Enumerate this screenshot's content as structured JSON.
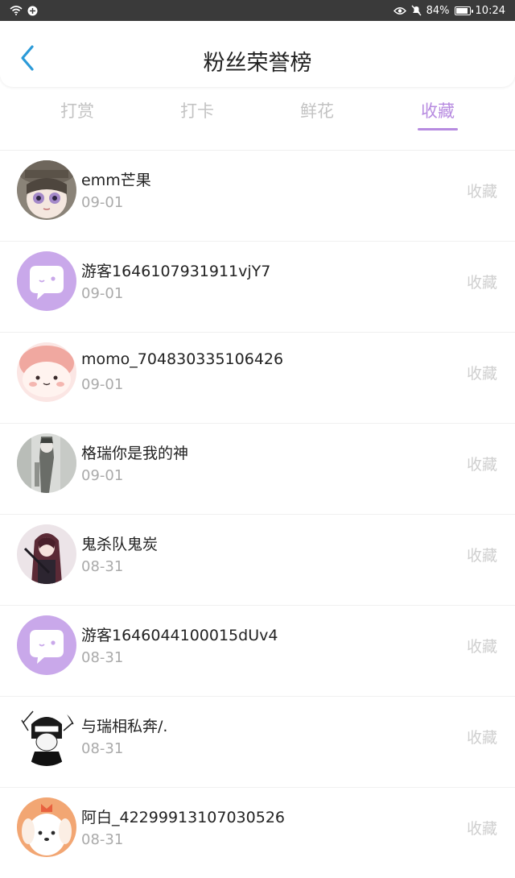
{
  "status_bar": {
    "battery": "84%",
    "time": "10:24",
    "icons": [
      "wifi-icon",
      "app-notification-icon",
      "eye-icon",
      "mute-icon",
      "battery-icon"
    ]
  },
  "header": {
    "title": "粉丝荣誉榜",
    "back_icon": "chevron-left-icon",
    "accent": "#2b9ad8"
  },
  "tabs": [
    {
      "label": "打赏"
    },
    {
      "label": "打卡"
    },
    {
      "label": "鲜花"
    },
    {
      "label": "收藏",
      "active": true
    }
  ],
  "colors": {
    "accent": "#b78be0",
    "inactive_tab": "#c3c3c3",
    "action": "#cfcfcf"
  },
  "fans": [
    {
      "name": "emm芒果",
      "date": "09-01",
      "action": "收藏",
      "avatar": "anime-girl-avatar"
    },
    {
      "name": "游客1646107931911vjY7",
      "date": "09-01",
      "action": "收藏",
      "avatar": "default-chat-bubble-avatar"
    },
    {
      "name": "momo_704830335106426",
      "date": "09-01",
      "action": "收藏",
      "avatar": "pink-blob-avatar"
    },
    {
      "name": "格瑞你是我的神",
      "date": "09-01",
      "action": "收藏",
      "avatar": "sketch-character-avatar"
    },
    {
      "name": "鬼杀队鬼炭",
      "date": "08-31",
      "action": "收藏",
      "avatar": "dark-hair-anime-avatar"
    },
    {
      "name": "游客1646044100015dUv4",
      "date": "08-31",
      "action": "收藏",
      "avatar": "default-chat-bubble-avatar"
    },
    {
      "name": "与瑞相私奔/.",
      "date": "08-31",
      "action": "收藏",
      "avatar": "manga-character-avatar"
    },
    {
      "name": "阿白_42299913107030526",
      "date": "08-31",
      "action": "收藏",
      "avatar": "orange-dog-avatar"
    }
  ]
}
